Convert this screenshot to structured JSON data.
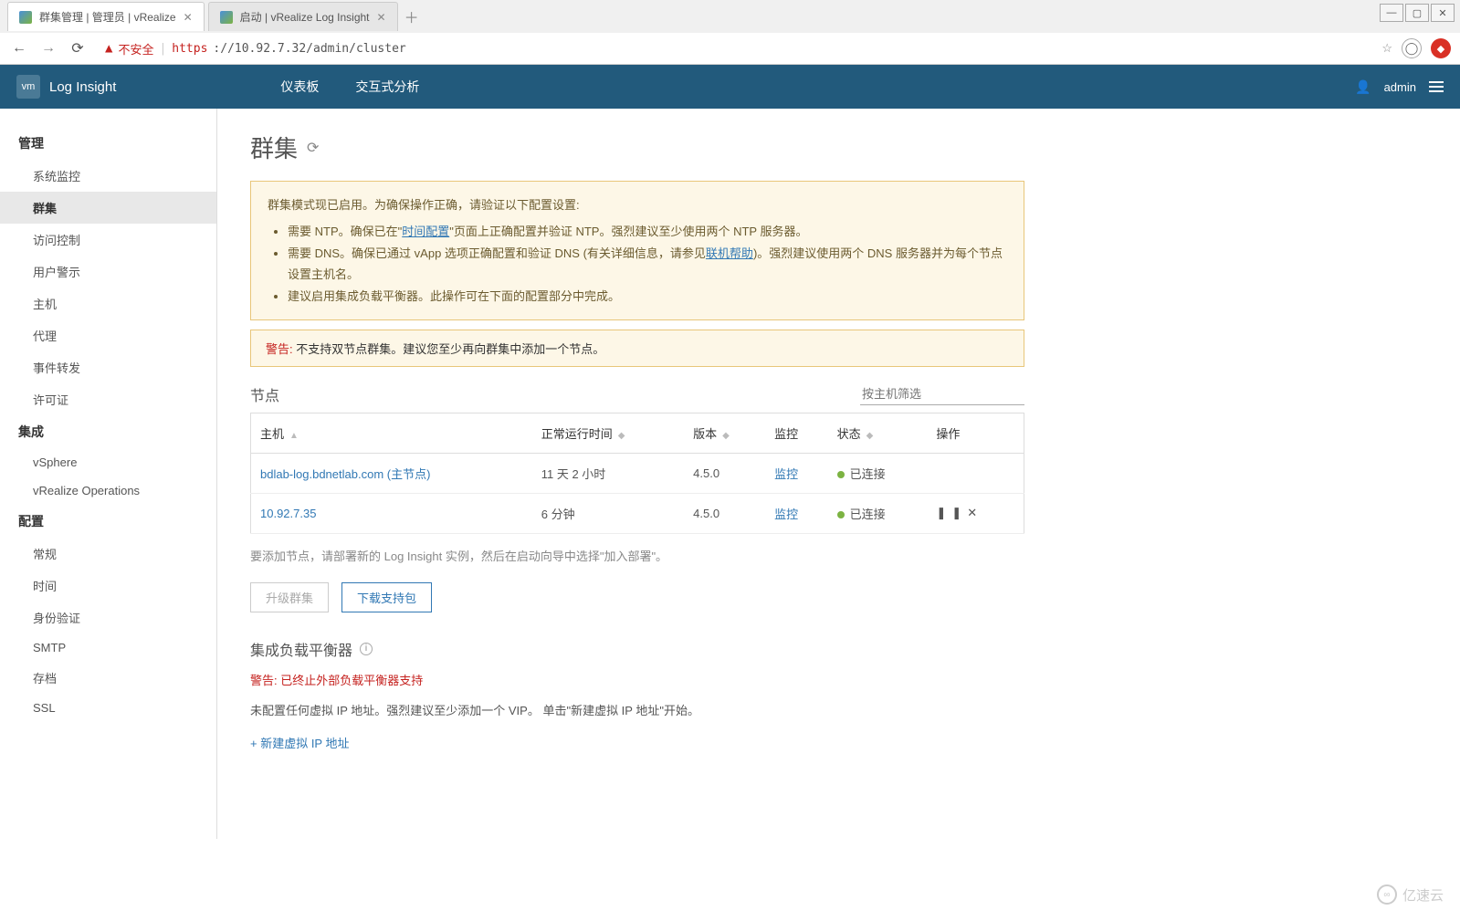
{
  "browser": {
    "tabs": [
      {
        "title": "群集管理 | 管理员 | vRealize",
        "active": true
      },
      {
        "title": "启动 | vRealize Log Insight",
        "active": false
      }
    ],
    "not_secure_label": "不安全",
    "url_https": "https",
    "url_rest": "://10.92.7.32/admin/cluster"
  },
  "header": {
    "logo_text": "vm",
    "brand": "Log Insight",
    "nav": [
      "仪表板",
      "交互式分析"
    ],
    "user": "admin"
  },
  "sidebar": {
    "sections": [
      {
        "title": "管理",
        "items": [
          "系统监控",
          "群集",
          "访问控制",
          "用户警示",
          "主机",
          "代理",
          "事件转发",
          "许可证"
        ]
      },
      {
        "title": "集成",
        "items": [
          "vSphere",
          "vRealize Operations"
        ]
      },
      {
        "title": "配置",
        "items": [
          "常规",
          "时间",
          "身份验证",
          "SMTP",
          "存档",
          "SSL"
        ]
      }
    ],
    "active": "群集"
  },
  "page": {
    "title": "群集",
    "alert_intro": "群集模式现已启用。为确保操作正确，请验证以下配置设置:",
    "alert_items": [
      {
        "pre": "需要 NTP。确保已在\"",
        "link": "时间配置",
        "post": "\"页面上正确配置并验证 NTP。强烈建议至少使用两个 NTP 服务器。"
      },
      {
        "pre": "需要 DNS。确保已通过 vApp 选项正确配置和验证 DNS (有关详细信息，请参见",
        "link": "联机帮助",
        "post": ")。强烈建议使用两个 DNS 服务器并为每个节点设置主机名。"
      },
      {
        "pre": "建议启用集成负载平衡器。此操作可在下面的配置部分中完成。",
        "link": "",
        "post": ""
      }
    ],
    "warn_label": "警告:",
    "warn_text": " 不支持双节点群集。建议您至少再向群集中添加一个节点。",
    "nodes_title": "节点",
    "filter_placeholder": "按主机筛选",
    "columns": [
      "主机",
      "正常运行时间",
      "版本",
      "监控",
      "状态",
      "操作"
    ],
    "rows": [
      {
        "host": "bdlab-log.bdnetlab.com (主节点)",
        "uptime": "11 天 2 小时",
        "version": "4.5.0",
        "monitor": "监控",
        "status": "已连接",
        "actions": ""
      },
      {
        "host": "10.92.7.35",
        "uptime": "6 分钟",
        "version": "4.5.0",
        "monitor": "监控",
        "status": "已连接",
        "actions": "⏸ ✕"
      }
    ],
    "note": "要添加节点，请部署新的 Log Insight 实例，然后在启动向导中选择\"加入部署\"。",
    "btn_upgrade": "升级群集",
    "btn_download": "下载支持包",
    "ilb_title": "集成负载平衡器",
    "ilb_warn": "已终止外部负载平衡器支持",
    "ilb_desc": "未配置任何虚拟 IP 地址。强烈建议至少添加一个 VIP。 单击\"新建虚拟 IP 地址\"开始。",
    "ilb_add": "+ 新建虚拟 IP 地址"
  },
  "watermark": "亿速云"
}
